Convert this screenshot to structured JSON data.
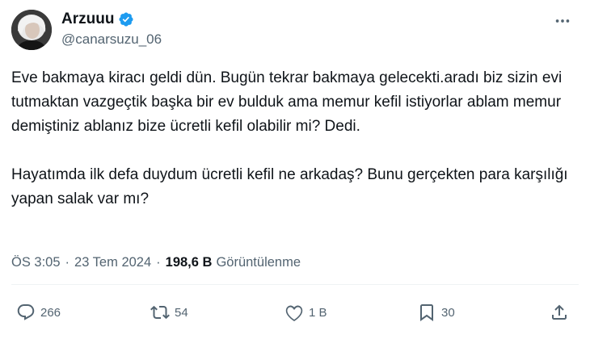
{
  "author": {
    "display_name": "Arzuuu",
    "handle": "@canarsuzu_06",
    "verified": true
  },
  "tweet": {
    "paragraphs": [
      "Eve bakmaya kiracı geldi dün. Bugün tekrar bakmaya gelecekti.aradı biz sizin evi tutmaktan vazgeçtik başka bir ev bulduk ama memur kefil istiyorlar ablam memur demiştiniz ablanız bize ücretli kefil olabilir mi? Dedi.",
      "Hayatımda ilk defa duydum ücretli kefil ne arkadaş? Bunu gerçekten para karşılığı yapan salak var mı?"
    ]
  },
  "meta": {
    "time": "ÖS 3:05",
    "separator": "·",
    "date": "23 Tem 2024",
    "views_count": "198,6 B",
    "views_label": "Görüntülenme"
  },
  "actions": {
    "replies": "266",
    "retweets": "54",
    "likes": "1 B",
    "bookmarks": "30"
  },
  "icons": {
    "verified": "verified-badge-icon",
    "more": "more-icon",
    "reply": "reply-icon",
    "retweet": "retweet-icon",
    "like": "heart-icon",
    "bookmark": "bookmark-icon",
    "share": "share-icon"
  },
  "colors": {
    "primary_text": "#0f1419",
    "secondary_text": "#536471",
    "verified_blue": "#1d9bf0",
    "divider": "#eff3f4"
  }
}
